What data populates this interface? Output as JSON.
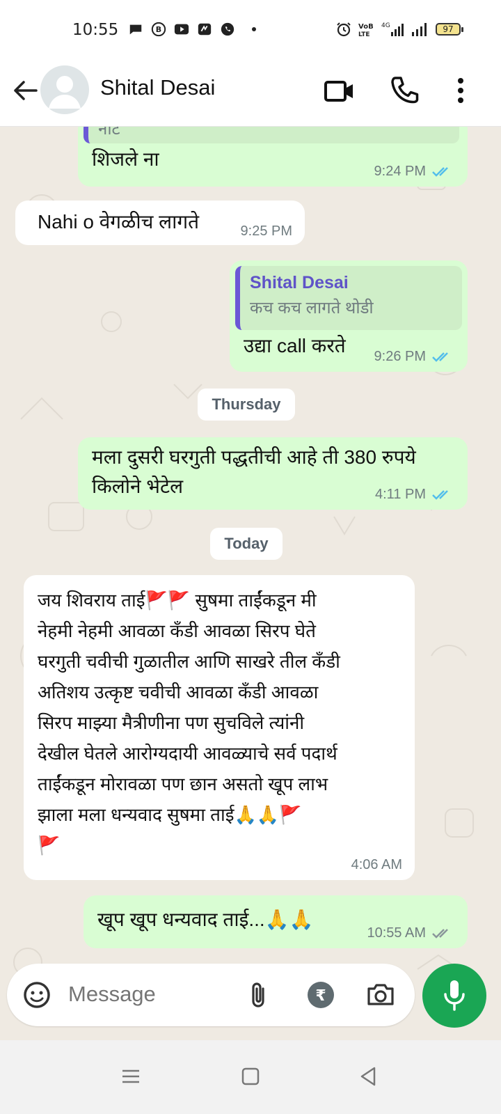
{
  "status_bar": {
    "time": "10:55",
    "battery": "97",
    "network": "4G"
  },
  "header": {
    "contact_name": "Shital Desai",
    "icons": [
      "back-arrow-icon",
      "avatar",
      "video-call-icon",
      "phone-icon",
      "more-vert-icon"
    ]
  },
  "messages": [
    {
      "dir": "out",
      "quote_fragment": "नाट",
      "text": "शिजले ना",
      "time": "9:24 PM",
      "status": "read"
    },
    {
      "dir": "in",
      "text": "Nahi o वेगळीच लागते",
      "time": "9:25 PM"
    },
    {
      "dir": "out",
      "quote_name": "Shital Desai",
      "quote_text": "कच कच लागते थोडी",
      "text": "उद्या call करते",
      "time": "9:26 PM",
      "status": "read"
    },
    {
      "type": "day",
      "text": "Thursday"
    },
    {
      "dir": "out",
      "line1": "मला दुसरी घरगुती पद्धतीची आहे ती 380 रुपये",
      "line2": "किलोने भेटेल",
      "time": "4:11 PM",
      "status": "read"
    },
    {
      "type": "day",
      "text": "Today"
    },
    {
      "dir": "in",
      "lines": [
        "जय शिवराय ताई🚩🚩 सुषमा ताईंकडून मी",
        "नेहमी नेहमी आवळा कँडी आवळा सिरप घेते",
        "घरगुती चवीची गुळातील आणि साखरे तील कँडी",
        "अतिशय उत्कृष्ट चवीची आवळा कँडी आवळा",
        "सिरप माझ्या मैत्रीणीना पण सुचविले त्यांनी",
        "देखील घेतले आरोग्यदायी आवळ्याचे सर्व पदार्थ",
        "ताईंकडून मोरावळा पण छान असतो खूप लाभ",
        "झाला मला धन्यवाद सुषमा ताई🙏🙏🚩",
        "🚩"
      ],
      "time": "4:06 AM"
    },
    {
      "dir": "out",
      "text": "खूप खूप धन्यवाद ताई...🙏🙏",
      "time": "10:55 AM",
      "status": "delivered"
    }
  ],
  "composer": {
    "placeholder": "Message",
    "icons": [
      "sticker-icon",
      "attach-icon",
      "rupee-payment-icon",
      "camera-icon",
      "mic-icon"
    ]
  },
  "colors": {
    "outgoing_bubble": "#d9fdd3",
    "incoming_bubble": "#ffffff",
    "chat_background": "#efeae2",
    "read_ticks": "#53bdeb",
    "mic_button": "#1aa654",
    "quote_bar": "#6b58d6"
  }
}
